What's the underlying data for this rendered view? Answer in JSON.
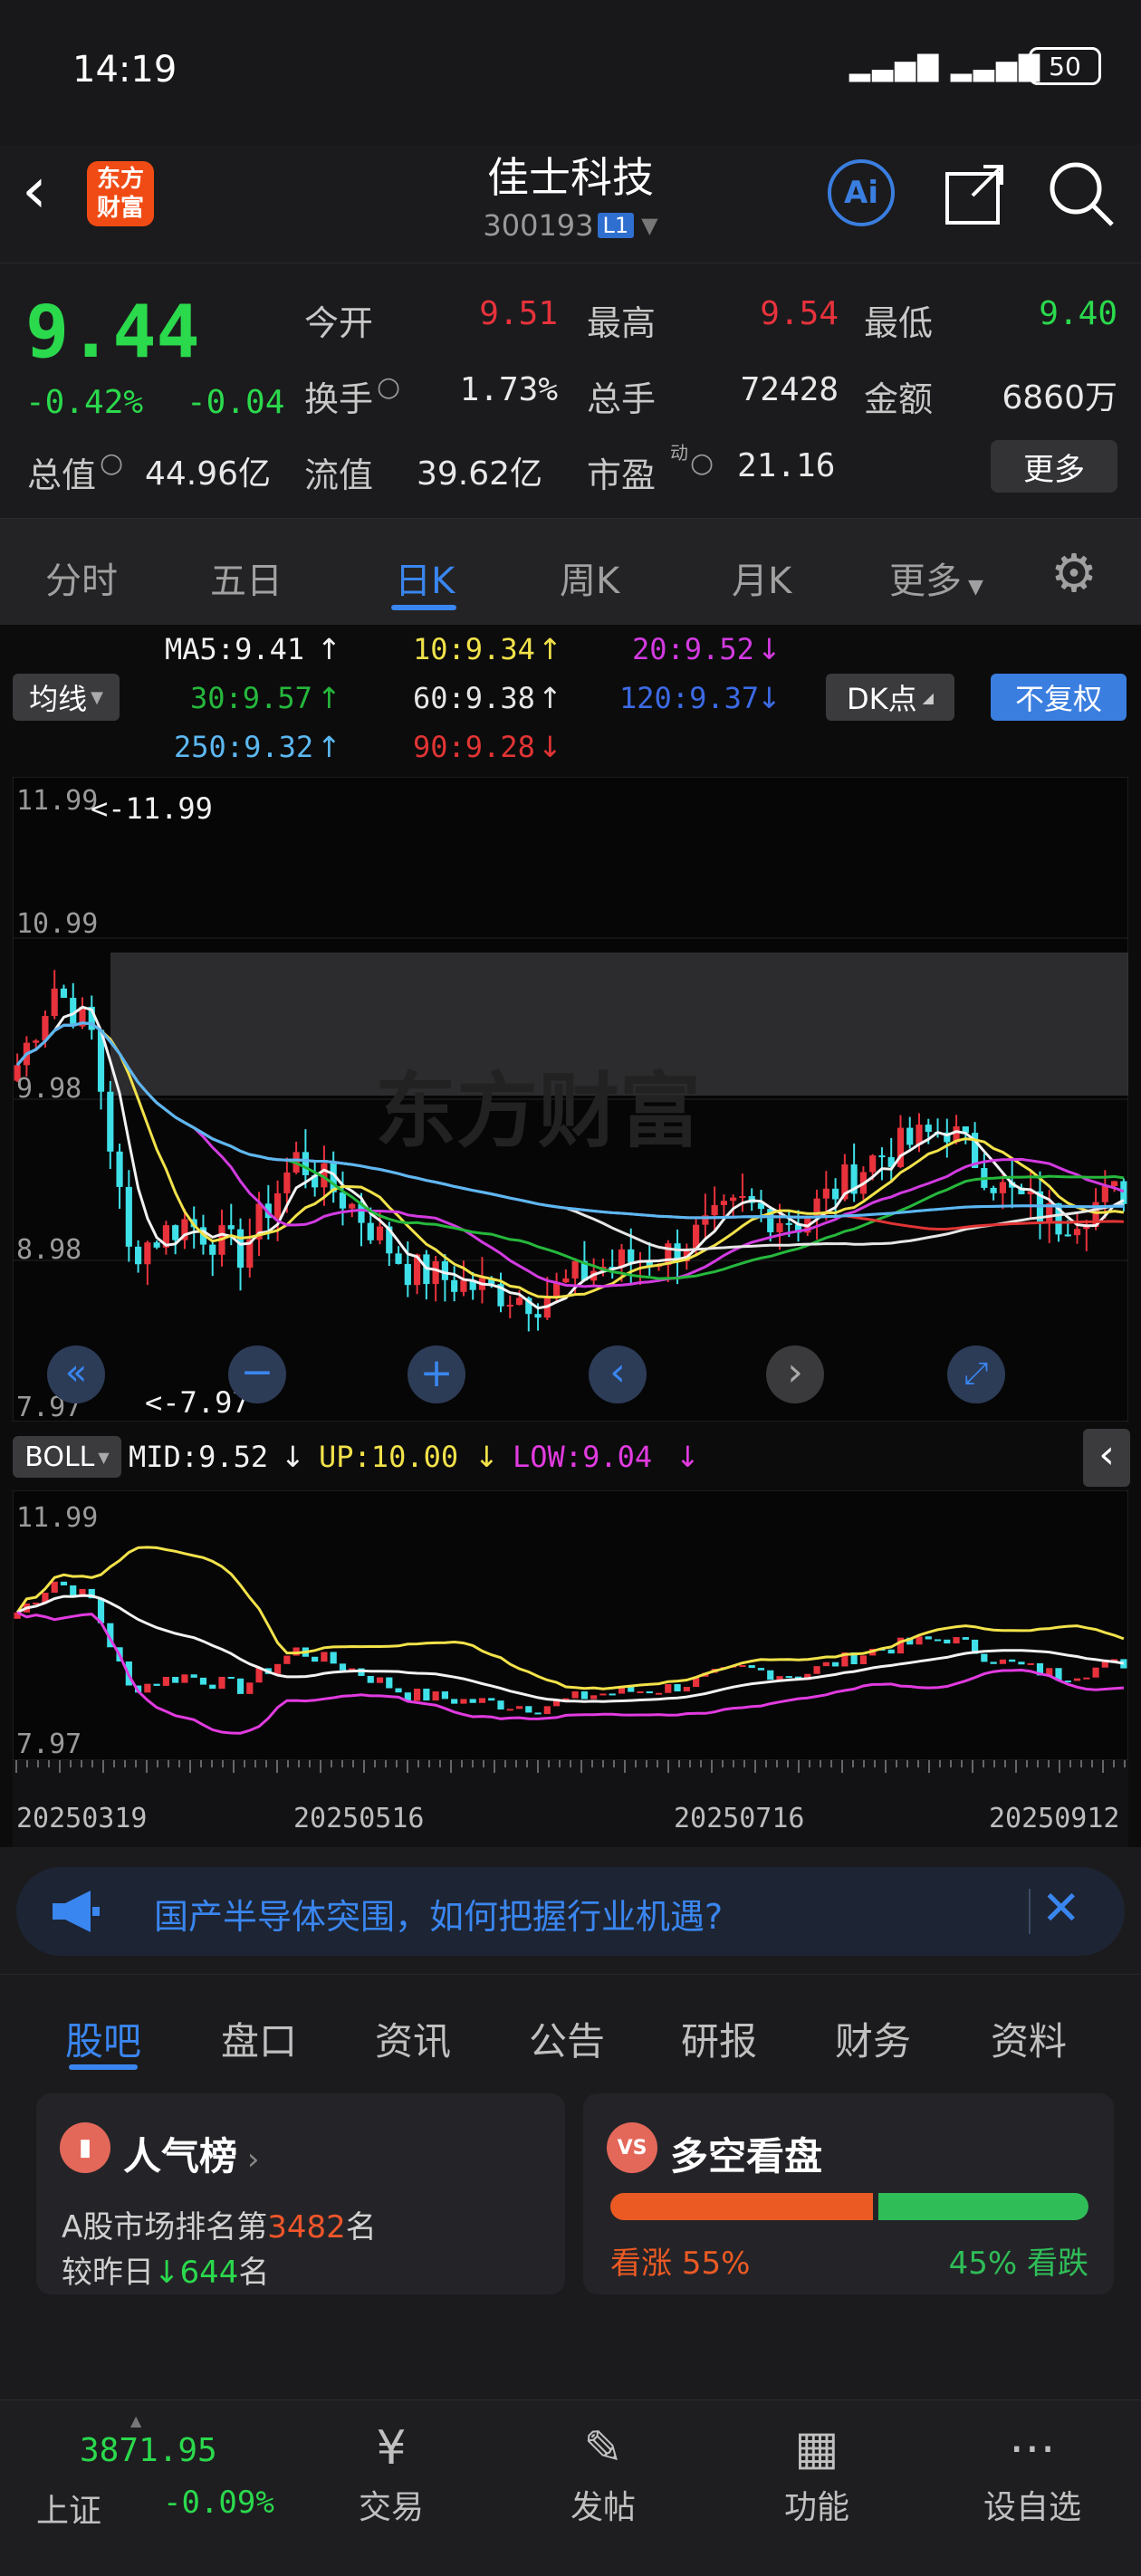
{
  "status": {
    "time": "14:19",
    "battery": "50",
    "signal_text": "▂▃▅▇  ▂▃▅▇"
  },
  "header": {
    "logo_line1": "东方",
    "logo_line2": "财富",
    "name": "佳士科技",
    "code": "300193",
    "market_badge": "L1",
    "ai_label": "Ai"
  },
  "quote": {
    "price": "9.44",
    "change_pct": "-0.42%",
    "change_abs": "-0.04",
    "open_label": "今开",
    "open": "9.51",
    "high_label": "最高",
    "high": "9.54",
    "low_label": "最低",
    "low": "9.40",
    "turnover_label": "换手",
    "turnover": "1.73%",
    "volume_label": "总手",
    "volume": "72428",
    "amount_label": "金额",
    "amount": "6860万",
    "mcap_label": "总值",
    "mcap": "44.96亿",
    "float_label": "流值",
    "float": "39.62亿",
    "pe_label": "市盈",
    "pe_sup": "动",
    "pe": "21.16",
    "more": "更多"
  },
  "period_tabs": [
    "分时",
    "五日",
    "日K",
    "周K",
    "月K",
    "更多"
  ],
  "ma": {
    "select": "均线",
    "ma5": "MA5:9.41",
    "ma10": "10:9.34",
    "ma20": "20:9.52",
    "ma30": "30:9.57",
    "ma60": "60:9.38",
    "ma120": "120:9.37",
    "ma250": "250:9.32",
    "ma90": "90:9.28",
    "dk": "DK点",
    "adj": "不复权"
  },
  "chart_labels": {
    "y_top": "11.99",
    "y_mid1": "10.99",
    "y_mid2": "9.98",
    "y_mid3": "8.98",
    "y_bottom": "7.97",
    "max_marker": "<-11.99",
    "min_marker": "<-7.97",
    "watermark": "东方财富"
  },
  "boll": {
    "select": "BOLL",
    "mid": "MID:9.52",
    "up": "UP:10.00",
    "low": "LOW:9.04",
    "y_top": "11.99",
    "y_bottom": "7.97"
  },
  "dates": [
    "20250319",
    "20250516",
    "20250716",
    "20250912"
  ],
  "banner": {
    "text": "国产半导体突围，如何把握行业机遇?"
  },
  "info_tabs": [
    "股吧",
    "盘口",
    "资讯",
    "公告",
    "研报",
    "财务",
    "资料"
  ],
  "popularity": {
    "title": "人气榜",
    "rank_prefix": "A股市场排名第",
    "rank": "3482",
    "rank_suffix": "名",
    "cmp_prefix": "较昨日",
    "cmp": "644",
    "cmp_suffix": "名"
  },
  "longshort": {
    "title": "多空看盘",
    "bull_label": "看涨",
    "bull": "55%",
    "bear": "45%",
    "bear_label": "看跌",
    "bull_fraction": 0.55
  },
  "bottom": {
    "index_value": "3871.95",
    "index_name": "上证",
    "index_change": "-0.09%",
    "trade": "交易",
    "post": "发帖",
    "func": "功能",
    "custom": "设自选"
  },
  "colors": {
    "up": "#e8323c",
    "down": "#2bd94d",
    "accent": "#3a86f0"
  },
  "chart_data": {
    "type": "line",
    "x": [
      "20250319",
      "20250516",
      "20250716",
      "20250912"
    ],
    "ylim": [
      7.97,
      11.99
    ],
    "series": [
      {
        "name": "MA5",
        "values": [
          9.41
        ]
      },
      {
        "name": "10",
        "values": [
          9.34
        ]
      },
      {
        "name": "20",
        "values": [
          9.52
        ]
      },
      {
        "name": "30",
        "values": [
          9.57
        ]
      },
      {
        "name": "60",
        "values": [
          9.38
        ]
      },
      {
        "name": "120",
        "values": [
          9.37
        ]
      },
      {
        "name": "250",
        "values": [
          9.32
        ]
      },
      {
        "name": "90",
        "values": [
          9.28
        ]
      },
      {
        "name": "MID",
        "values": [
          9.52
        ]
      },
      {
        "name": "UP",
        "values": [
          10.0
        ]
      },
      {
        "name": "LOW",
        "values": [
          9.04
        ]
      }
    ]
  }
}
